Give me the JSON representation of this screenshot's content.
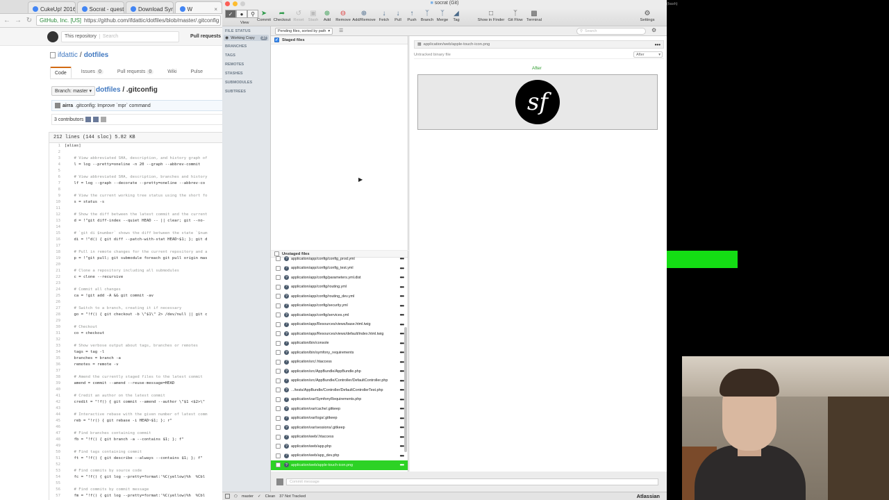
{
  "browser": {
    "tabs": [
      {
        "title": "CukeUp! 2016 - t...",
        "active": false
      },
      {
        "title": "Socrat - question...",
        "active": false
      },
      {
        "title": "Download Symfon...",
        "active": false
      },
      {
        "title": "W",
        "active": true
      }
    ],
    "address": {
      "secure_label": "GitHub, Inc. [US]",
      "url": "https://github.com/ifdattic/dotfiles/blob/master/.gitconfig"
    },
    "github": {
      "search_label": "This repository",
      "search_placeholder": "Search",
      "nav_pull_requests": "Pull requests",
      "owner": "ifdattic",
      "separator": "/",
      "repo": "dotfiles",
      "tabs": [
        {
          "label": "Code",
          "count": ""
        },
        {
          "label": "Issues",
          "count": "0"
        },
        {
          "label": "Pull requests",
          "count": "0"
        },
        {
          "label": "Wiki",
          "count": ""
        },
        {
          "label": "Pulse",
          "count": ""
        }
      ],
      "branch_label": "Branch: master",
      "path_dir": "dotfiles",
      "path_file": "/ .gitconfig",
      "commit_author": "airra",
      "commit_message": ".gitconfig: Improve `mpr` command",
      "contributors": "3 contributors",
      "file_info": "212 lines (144 sloc)     5.82 KB",
      "code_lines": [
        {
          "n": "1",
          "t": "[alias]",
          "c": false
        },
        {
          "n": "2",
          "t": "",
          "c": false
        },
        {
          "n": "3",
          "t": "    # View abbreviated SHA, description, and history graph of",
          "c": true
        },
        {
          "n": "4",
          "t": "    l = log --pretty=oneline -n 20 --graph --abbrev-commit",
          "c": false
        },
        {
          "n": "5",
          "t": "",
          "c": false
        },
        {
          "n": "6",
          "t": "    # View abbreviated SHA, description, branches and history",
          "c": true
        },
        {
          "n": "7",
          "t": "    lf = log --graph --decorate --pretty=oneline --abbrev-co",
          "c": false
        },
        {
          "n": "8",
          "t": "",
          "c": false
        },
        {
          "n": "9",
          "t": "    # View the current working tree status using the short fo",
          "c": true
        },
        {
          "n": "10",
          "t": "    s = status -s",
          "c": false
        },
        {
          "n": "11",
          "t": "",
          "c": false
        },
        {
          "n": "12",
          "t": "    # Show the diff between the latest commit and the current",
          "c": true
        },
        {
          "n": "13",
          "t": "    d = !\"git diff-index --quiet HEAD -- || clear; git --no-",
          "c": false
        },
        {
          "n": "14",
          "t": "",
          "c": false
        },
        {
          "n": "15",
          "t": "    # `git di $number` shows the diff between the state `$num",
          "c": true
        },
        {
          "n": "16",
          "t": "    di = !\"d() { git diff --patch-with-stat HEAD~$1; }; git d",
          "c": false
        },
        {
          "n": "17",
          "t": "",
          "c": false
        },
        {
          "n": "18",
          "t": "    # Pull in remote changes for the current repository and a",
          "c": true
        },
        {
          "n": "19",
          "t": "    p = !\"git pull; git submodule foreach git pull origin mas",
          "c": false
        },
        {
          "n": "20",
          "t": "",
          "c": false
        },
        {
          "n": "21",
          "t": "    # Clone a repository including all submodules",
          "c": true
        },
        {
          "n": "22",
          "t": "    c = clone --recursive",
          "c": false
        },
        {
          "n": "23",
          "t": "",
          "c": false
        },
        {
          "n": "24",
          "t": "    # Commit all changes",
          "c": true
        },
        {
          "n": "25",
          "t": "    ca = !git add -A && git commit -av",
          "c": false
        },
        {
          "n": "26",
          "t": "",
          "c": false
        },
        {
          "n": "27",
          "t": "    # Switch to a branch, creating it if necessary",
          "c": true
        },
        {
          "n": "28",
          "t": "    go = \"!f() { git checkout -b \\\"$1\\\" 2> /dev/null || git c",
          "c": false
        },
        {
          "n": "29",
          "t": "",
          "c": false
        },
        {
          "n": "30",
          "t": "    # Checkout",
          "c": true
        },
        {
          "n": "31",
          "t": "    co = checkout",
          "c": false
        },
        {
          "n": "32",
          "t": "",
          "c": false
        },
        {
          "n": "33",
          "t": "    # Show verbose output about tags, branches or remotes",
          "c": true
        },
        {
          "n": "34",
          "t": "    tags = tag -l",
          "c": false
        },
        {
          "n": "35",
          "t": "    branches = branch -a",
          "c": false
        },
        {
          "n": "36",
          "t": "    remotes = remote -v",
          "c": false
        },
        {
          "n": "37",
          "t": "",
          "c": false
        },
        {
          "n": "38",
          "t": "    # Amend the currently staged files to the latest commit",
          "c": true
        },
        {
          "n": "39",
          "t": "    amend = commit --amend --reuse-message=HEAD",
          "c": false
        },
        {
          "n": "40",
          "t": "",
          "c": false
        },
        {
          "n": "41",
          "t": "    # Credit an author on the latest commit",
          "c": true
        },
        {
          "n": "42",
          "t": "    credit = \"!f() { git commit --amend --author \\\"$1 <$2>\\\"",
          "c": false
        },
        {
          "n": "43",
          "t": "",
          "c": false
        },
        {
          "n": "44",
          "t": "    # Interactive rebase with the given number of latest comm",
          "c": true
        },
        {
          "n": "45",
          "t": "    reb = \"!r() { git rebase -i HEAD~$1; }; r\"",
          "c": false
        },
        {
          "n": "46",
          "t": "",
          "c": false
        },
        {
          "n": "47",
          "t": "    # Find branches containing commit",
          "c": true
        },
        {
          "n": "48",
          "t": "    fb = \"!f() { git branch -a --contains $1; }; f\"",
          "c": false
        },
        {
          "n": "49",
          "t": "",
          "c": false
        },
        {
          "n": "50",
          "t": "    # Find tags containing commit",
          "c": true
        },
        {
          "n": "51",
          "t": "    ft = \"!f() { git describe --always --contains $1; }; f\"",
          "c": false
        },
        {
          "n": "52",
          "t": "",
          "c": false
        },
        {
          "n": "53",
          "t": "    # Find commits by source code",
          "c": true
        },
        {
          "n": "54",
          "t": "    fc = \"!f() { git log --pretty=format:'%C(yellow)%h  %Cbl",
          "c": false
        },
        {
          "n": "55",
          "t": "",
          "c": false
        },
        {
          "n": "56",
          "t": "    # Find commits by commit message",
          "c": true
        },
        {
          "n": "57",
          "t": "    fm = \"!f() { git log --pretty=format:'%C(yellow)%h  %Cbl",
          "c": false
        }
      ]
    }
  },
  "sourcetree": {
    "title": "socrat (Git)",
    "toolbar": {
      "view_label": "View",
      "buttons": [
        {
          "label": "Commit",
          "icon": "commit-icon",
          "disabled": false
        },
        {
          "label": "Checkout",
          "icon": "checkout-icon",
          "disabled": false
        },
        {
          "label": "Reset",
          "icon": "reset-icon",
          "disabled": true
        },
        {
          "label": "Stash",
          "icon": "stash-icon",
          "disabled": true
        },
        {
          "label": "Add",
          "icon": "add-icon",
          "disabled": false
        },
        {
          "label": "Remove",
          "icon": "remove-icon",
          "disabled": false
        },
        {
          "label": "Add/Remove",
          "icon": "add-remove-icon",
          "disabled": false
        },
        {
          "label": "Fetch",
          "icon": "fetch-icon",
          "disabled": false
        },
        {
          "label": "Pull",
          "icon": "pull-icon",
          "disabled": false
        },
        {
          "label": "Push",
          "icon": "push-icon",
          "disabled": false
        },
        {
          "label": "Branch",
          "icon": "branch-icon",
          "disabled": false
        },
        {
          "label": "Merge",
          "icon": "merge-icon",
          "disabled": false
        },
        {
          "label": "Tag",
          "icon": "tag-icon",
          "disabled": false
        },
        {
          "label": "Show in Finder",
          "icon": "finder-icon",
          "disabled": false
        },
        {
          "label": "Git Flow",
          "icon": "git-flow-icon",
          "disabled": false
        },
        {
          "label": "Terminal",
          "icon": "terminal-icon",
          "disabled": false
        },
        {
          "label": "Settings",
          "icon": "settings-icon",
          "disabled": false
        }
      ]
    },
    "sidebar": {
      "file_status_header": "FILE STATUS",
      "working_copy_label": "Working Copy",
      "working_copy_count": "37",
      "sections": [
        "BRANCHES",
        "TAGS",
        "REMOTES",
        "STASHES",
        "SUBMODULES",
        "SUBTREES"
      ]
    },
    "filter": {
      "dropdown_label": "Pending files, sorted by path",
      "search_placeholder": "Search"
    },
    "staged": {
      "header": "Staged files"
    },
    "unstaged": {
      "header": "Unstaged files",
      "files": [
        "application/app/config/config_prod.yml",
        "application/app/config/config_test.yml",
        "application/app/config/parameters.yml.dist",
        "application/app/config/routing.yml",
        "application/app/config/routing_dev.yml",
        "application/app/config/security.yml",
        "application/app/config/services.yml",
        "application/app/Resources/views/base.html.twig",
        "application/app/Resources/views/default/index.html.twig",
        "application/bin/console",
        "application/bin/symfony_requirements",
        "application/src/.htaccess",
        "application/src/AppBundle/AppBundle.php",
        "application/src/AppBundle/Controller/DefaultController.php",
        ".../tests/AppBundle/Controller/DefaultControllerTest.php",
        "application/var/SymfonyRequirements.php",
        "application/var/cache/.gitkeep",
        "application/var/logs/.gitkeep",
        "application/var/sessions/.gitkeep",
        "application/web/.htaccess",
        "application/web/app.php",
        "application/web/app_dev.php",
        "application/web/apple-touch-icon.png"
      ],
      "selected_index": 22
    },
    "diff": {
      "file_path": "application/web/apple-touch-icon.png",
      "subtitle": "Untracked binary file",
      "mode_dropdown": "After",
      "after_label": "After",
      "logo_glyph": "sf"
    },
    "commit": {
      "placeholder": "Commit message"
    },
    "status": {
      "branch": "master",
      "clean": "Clean",
      "not_tracked": "37 Not Tracked",
      "brand": "Atlassian"
    }
  },
  "terminal": {
    "title": "(bash)"
  },
  "colors": {
    "selection_green": "#2dd225",
    "overlay_green": "#14dd14",
    "github_link": "#4078c0"
  }
}
